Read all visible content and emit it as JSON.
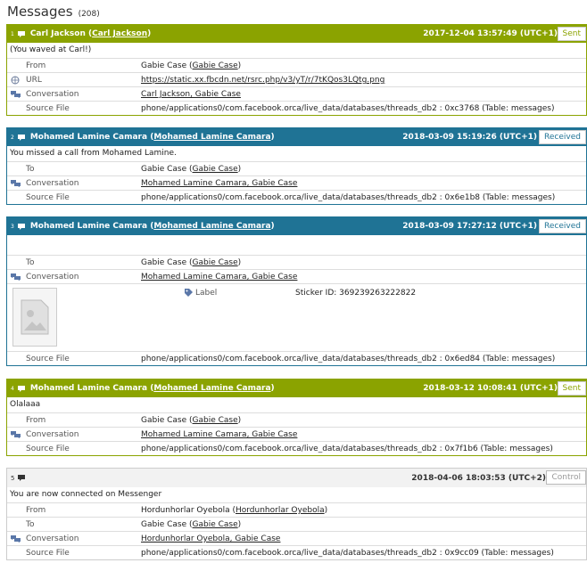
{
  "header": {
    "title": "Messages",
    "count": "(208)"
  },
  "colors": {
    "sent": "#8ba300",
    "received": "#1f7395",
    "control": "#f2f2f2"
  },
  "messages": [
    {
      "index": "1",
      "sender": "Carl Jackson",
      "sender_link": "Carl Jackson",
      "timestamp": "2017-12-04 13:57:49 (UTC+1)",
      "status": "Sent",
      "body": "(You waved at Carl!)",
      "rows": [
        {
          "label": "From",
          "value": "Gabie Case",
          "link": "Gabie Case"
        },
        {
          "label": "URL",
          "value": "https://static.xx.fbcdn.net/rsrc.php/v3/yT/r/7tKQos3LQtg.png",
          "icon": "globe-icon"
        },
        {
          "label": "Conversation",
          "value": "Carl Jackson, Gabie Case",
          "icon": "conversation-icon"
        },
        {
          "label": "Source File",
          "value": "phone/applications0/com.facebook.orca/live_data/databases/threads_db2 : 0xc3768 (Table: messages)"
        }
      ]
    },
    {
      "index": "2",
      "sender": "Mohamed Lamine Camara",
      "sender_link": "Mohamed Lamine Camara",
      "timestamp": "2018-03-09 15:19:26 (UTC+1)",
      "status": "Received",
      "body": "You missed a call from Mohamed Lamine.",
      "rows": [
        {
          "label": "To",
          "value": "Gabie Case",
          "link": "Gabie Case"
        },
        {
          "label": "Conversation",
          "value": "Mohamed Lamine Camara, Gabie Case",
          "icon": "conversation-icon"
        },
        {
          "label": "Source File",
          "value": "phone/applications0/com.facebook.orca/live_data/databases/threads_db2 : 0x6e1b8 (Table: messages)"
        }
      ]
    },
    {
      "index": "3",
      "sender": "Mohamed Lamine Camara",
      "sender_link": "Mohamed Lamine Camara",
      "timestamp": "2018-03-09 17:27:12 (UTC+1)",
      "status": "Received",
      "body": "",
      "rows": [
        {
          "label": "To",
          "value": "Gabie Case",
          "link": "Gabie Case"
        },
        {
          "label": "Conversation",
          "value": "Mohamed Lamine Camara, Gabie Case",
          "icon": "conversation-icon"
        }
      ],
      "sticker": {
        "label": "Label",
        "value": "Sticker ID: 369239263222822"
      },
      "source": {
        "label": "Source File",
        "value": "phone/applications0/com.facebook.orca/live_data/databases/threads_db2 : 0x6ed84 (Table: messages)"
      }
    },
    {
      "index": "4",
      "sender": "Mohamed Lamine Camara",
      "sender_link": "Mohamed Lamine Camara",
      "timestamp": "2018-03-12 10:08:41 (UTC+1)",
      "status": "Sent",
      "body": "Olalaaa",
      "rows": [
        {
          "label": "From",
          "value": "Gabie Case",
          "link": "Gabie Case"
        },
        {
          "label": "Conversation",
          "value": "Mohamed Lamine Camara, Gabie Case",
          "icon": "conversation-icon"
        },
        {
          "label": "Source File",
          "value": "phone/applications0/com.facebook.orca/live_data/databases/threads_db2 : 0x7f1b6 (Table: messages)"
        }
      ]
    },
    {
      "index": "5",
      "timestamp": "2018-04-06 18:03:53 (UTC+2)",
      "status": "Control",
      "body": "You are now connected on Messenger",
      "rows": [
        {
          "label": "From",
          "value": "Hordunhorlar Oyebola",
          "link": "Hordunhorlar Oyebola"
        },
        {
          "label": "To",
          "value": "Gabie Case",
          "link": "Gabie Case"
        },
        {
          "label": "Conversation",
          "value": "Hordunhorlar Oyebola, Gabie Case",
          "icon": "conversation-icon"
        },
        {
          "label": "Source File",
          "value": "phone/applications0/com.facebook.orca/live_data/databases/threads_db2 : 0x9cc09 (Table: messages)"
        }
      ]
    }
  ]
}
